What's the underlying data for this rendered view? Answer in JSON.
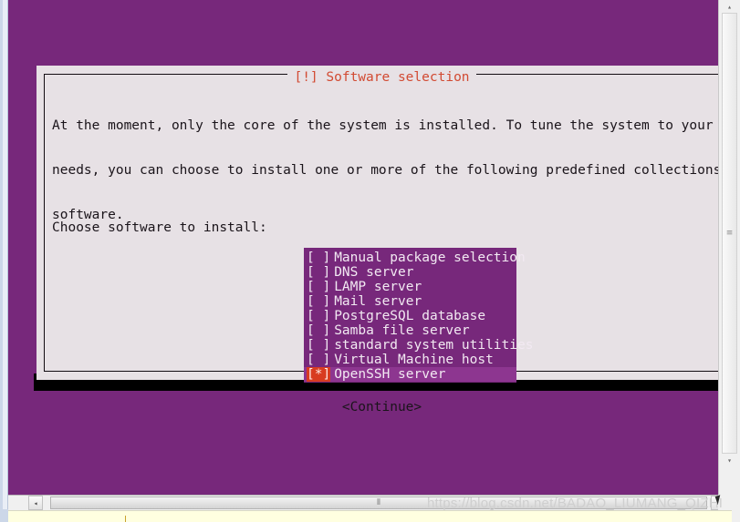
{
  "viewer": {
    "watermark": "https://blog.csdn.net/BADAO_LIUMANG_QIZHI",
    "hscroll": {
      "left_arrow": "◂",
      "right_arrow": "▸",
      "grip": "⦀"
    },
    "vscroll": {
      "up_arrow": "▴",
      "down_arrow": "▾",
      "grip": "≡"
    }
  },
  "dialog": {
    "title": "[!] Software selection",
    "paragraph_lines": [
      "At the moment, only the core of the system is installed. To tune the system to your",
      "needs, you can choose to install one or more of the following predefined collections of",
      "software."
    ],
    "prompt": "Choose software to install:",
    "continue_label": "<Continue>",
    "colors": {
      "console_purple": "#77287B",
      "dialog_bg": "#E7E1E5",
      "title_red": "#D24A32",
      "marker_red": "#D83C20",
      "list_text": "#F2E9F2"
    },
    "items": [
      {
        "marker": "[ ]",
        "label": "Manual package selection",
        "checked": false,
        "highlighted": false
      },
      {
        "marker": "[ ]",
        "label": "DNS server",
        "checked": false,
        "highlighted": false
      },
      {
        "marker": "[ ]",
        "label": "LAMP server",
        "checked": false,
        "highlighted": false
      },
      {
        "marker": "[ ]",
        "label": "Mail server",
        "checked": false,
        "highlighted": false
      },
      {
        "marker": "[ ]",
        "label": "PostgreSQL database",
        "checked": false,
        "highlighted": false
      },
      {
        "marker": "[ ]",
        "label": "Samba file server",
        "checked": false,
        "highlighted": false
      },
      {
        "marker": "[ ]",
        "label": "standard system utilities",
        "checked": false,
        "highlighted": false
      },
      {
        "marker": "[ ]",
        "label": "Virtual Machine host",
        "checked": false,
        "highlighted": false
      },
      {
        "marker": "[*]",
        "label": "OpenSSH server",
        "checked": true,
        "highlighted": true
      }
    ]
  }
}
